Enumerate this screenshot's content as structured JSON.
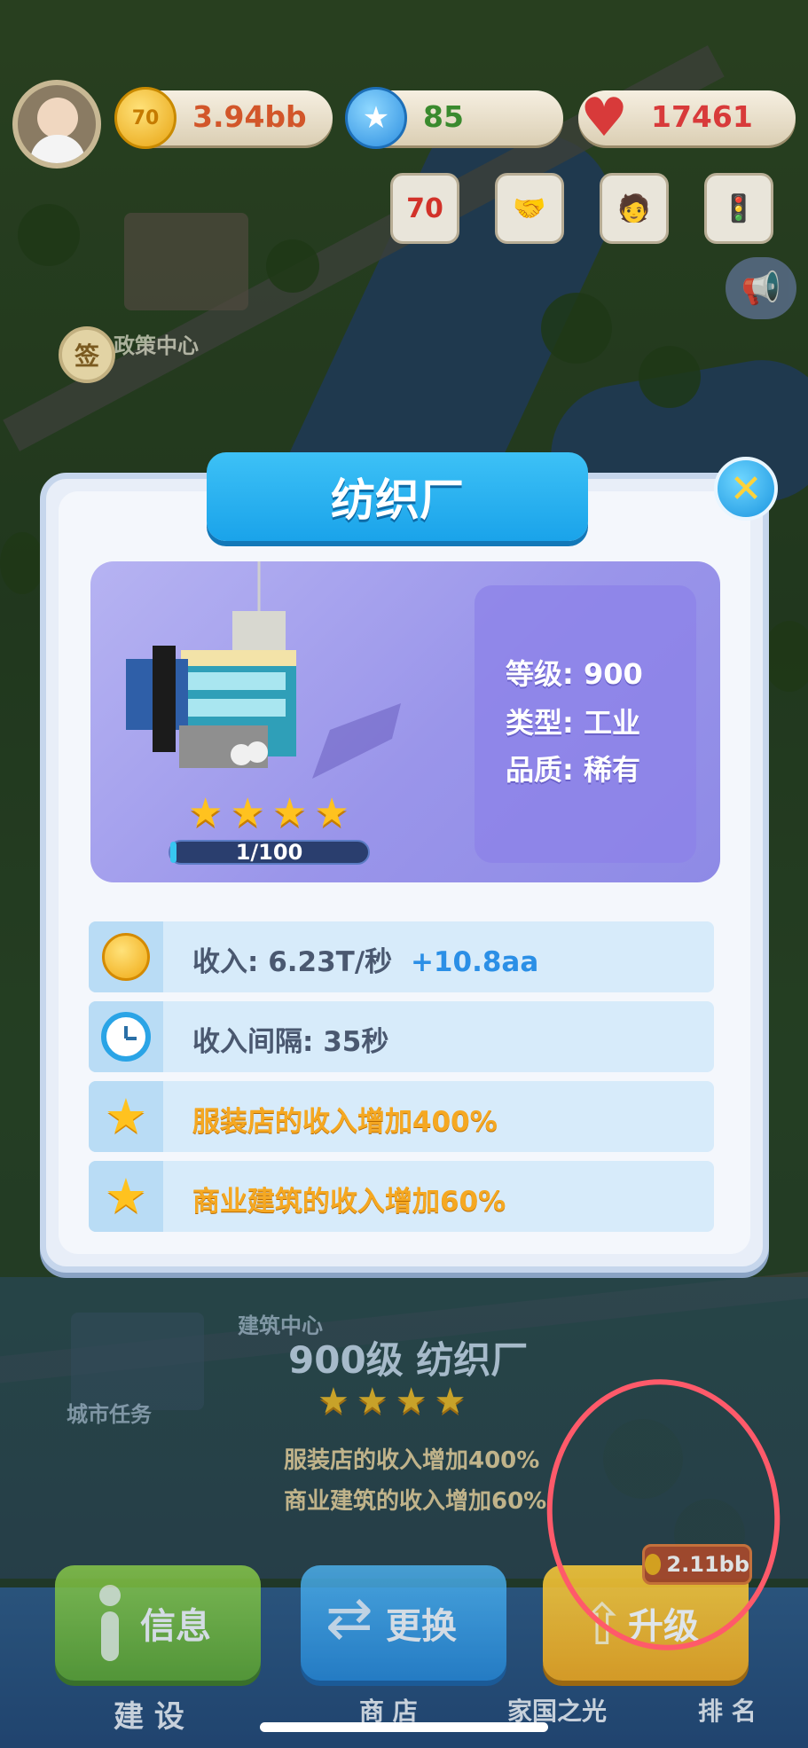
{
  "hud": {
    "coins": "3.94bb",
    "coin_badge": "70",
    "stars": "85",
    "hearts": "17461"
  },
  "map_labels": {
    "policy_center": "政策中心",
    "sign_badge": "签",
    "build_center": "建筑中心",
    "city_task": "城市任务"
  },
  "dialog": {
    "title": "纺织厂",
    "level": "等级: 900",
    "type": "类型: 工业",
    "quality": "品质: 稀有",
    "star_count": 4,
    "progress_text": "1/100",
    "progress_fraction": 0.01,
    "income_label": "收入: 6.23T/秒",
    "income_bonus": "+10.8aa",
    "interval": "收入间隔: 35秒",
    "buff1": "服装店的收入增加400%",
    "buff2": "商业建筑的收入增加60%"
  },
  "panel": {
    "title": "900级 纺织厂",
    "buff1": "服装店的收入增加400%",
    "buff2": "商业建筑的收入增加60%"
  },
  "buttons": {
    "info": "信息",
    "swap": "更换",
    "upgrade": "升级",
    "upgrade_cost": "2.11bb"
  },
  "nav": {
    "build": "建 设",
    "shop": "商 店",
    "homeland": "家国之光",
    "rank": "排 名"
  },
  "colors": {
    "coin_text": "#d2562a",
    "star_text": "#3a8a2e",
    "heart_text": "#d83a3a",
    "income_text": "#4a5870",
    "bonus_text": "#2b8fe6",
    "buff_text": "#f5a822",
    "highlight_circle": "#ff5a6a"
  }
}
